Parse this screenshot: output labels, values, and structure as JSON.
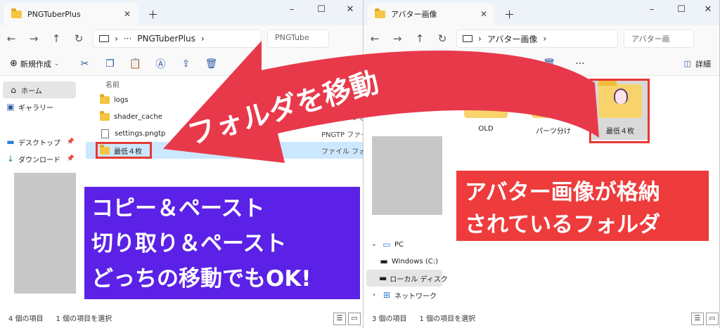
{
  "left_window": {
    "tab_title": "PNGTuberPlus",
    "breadcrumb": "PNGTuberPlus",
    "search_placeholder": "PNGTube",
    "toolbar_new": "新規作成",
    "sidebar": [
      {
        "label": "ホーム",
        "icon": "home-icon"
      },
      {
        "label": "ギャラリー",
        "icon": "gallery-icon"
      },
      {
        "label": "デスクトップ",
        "icon": "desktop-icon"
      },
      {
        "label": "ダウンロード",
        "icon": "download-icon"
      }
    ],
    "column_name": "名前",
    "files": [
      {
        "name": "logs",
        "type": ""
      },
      {
        "name": "shader_cache",
        "type": "ファイル フォルダー"
      },
      {
        "name": "settings.pngtp",
        "type": "PNGTP ファイル"
      },
      {
        "name": "最低４枚",
        "type": "ファイル フォルダー"
      }
    ],
    "status_count": "4 個の項目",
    "status_selected": "1 個の項目を選択"
  },
  "right_window": {
    "tab_title": "アバター画像",
    "breadcrumb": "アバター画像",
    "search_placeholder": "アバター画",
    "toolbar_details": "詳細",
    "sidebar": [
      {
        "label": "PC",
        "icon": "pc-icon"
      },
      {
        "label": "Windows (C:)",
        "icon": "drive-icon"
      },
      {
        "label": "ローカル ディスク",
        "icon": "drive-icon"
      },
      {
        "label": "ネットワーク",
        "icon": "network-icon"
      }
    ],
    "folders": [
      {
        "name": "OLD"
      },
      {
        "name": "パーツ分け"
      },
      {
        "name": "最低４枚"
      }
    ],
    "status_count": "3 個の項目",
    "status_selected": "1 個の項目を選択"
  },
  "annotations": {
    "arrow_label": "フォルダを移動",
    "purple_lines": [
      "コピー＆ペースト",
      "切り取り＆ペースト",
      "どっちの移動でもOK!"
    ],
    "red_lines": [
      "アバター画像が格納",
      "されているフォルダ"
    ]
  },
  "colors": {
    "arrow": "#e8394a",
    "purple_callout": "#5b21e6",
    "red_callout": "#ee3b3b",
    "highlight_box": "#e53935"
  }
}
